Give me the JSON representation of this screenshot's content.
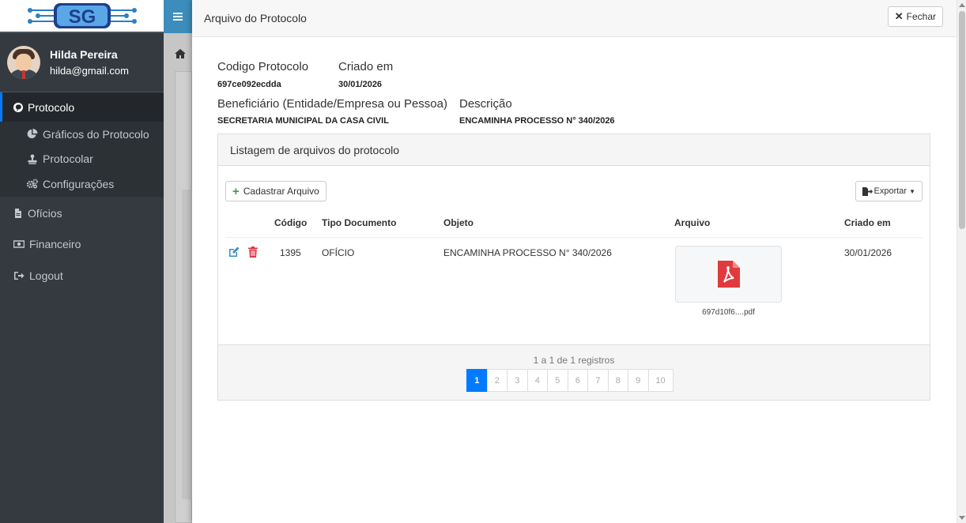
{
  "sidebar": {
    "brand_text": "SG",
    "user": {
      "name": "Hilda Pereira",
      "email": "hilda@gmail.com"
    },
    "items": [
      {
        "label": "Protocolo",
        "icon": "pinterest-icon"
      },
      {
        "label": "Ofícios",
        "icon": "file-icon"
      },
      {
        "label": "Financeiro",
        "icon": "money-icon"
      },
      {
        "label": "Logout",
        "icon": "sign-out-icon"
      }
    ],
    "subitems": [
      {
        "label": "Gráficos do Protocolo",
        "icon": "pie-chart-icon"
      },
      {
        "label": "Protocolar",
        "icon": "stamp-icon"
      },
      {
        "label": "Configurações",
        "icon": "cogs-icon"
      }
    ]
  },
  "modal": {
    "title": "Arquivo do Protocolo",
    "close_label": "Fechar",
    "fields": {
      "codigo_label": "Codigo Protocolo",
      "codigo_value": "697ce092ecdda",
      "criado_label": "Criado em",
      "criado_value": "30/01/2026",
      "beneficiario_label": "Beneficiário (Entidade/Empresa ou Pessoa)",
      "beneficiario_value": "SECRETARIA MUNICIPAL DA CASA CIVIL",
      "descricao_label": "Descrição",
      "descricao_value": "ENCAMINHA PROCESSO N° 340/2026"
    },
    "panel": {
      "heading": "Listagem de arquivos do protocolo",
      "add_button": "Cadastrar Arquivo",
      "export_button": "Exportar",
      "columns": [
        "Código",
        "Tipo Documento",
        "Objeto",
        "Arquivo",
        "Criado em"
      ],
      "rows": [
        {
          "codigo": "1395",
          "tipo": "OFÍCIO",
          "objeto": "ENCAMINHA PROCESSO N° 340/2026",
          "arquivo": "697d10f6....pdf",
          "criado": "30/01/2026"
        }
      ],
      "records_text": "1 a 1 de 1 registros",
      "pages": [
        "1",
        "2",
        "3",
        "4",
        "5",
        "6",
        "7",
        "8",
        "9",
        "10"
      ],
      "current_page": "1"
    }
  },
  "colors": {
    "sidebar_bg": "#343a40",
    "accent": "#007bff",
    "pdf_red": "#e03a3e",
    "delete_red": "#dc3545",
    "edit_blue": "#3c8dbc"
  }
}
